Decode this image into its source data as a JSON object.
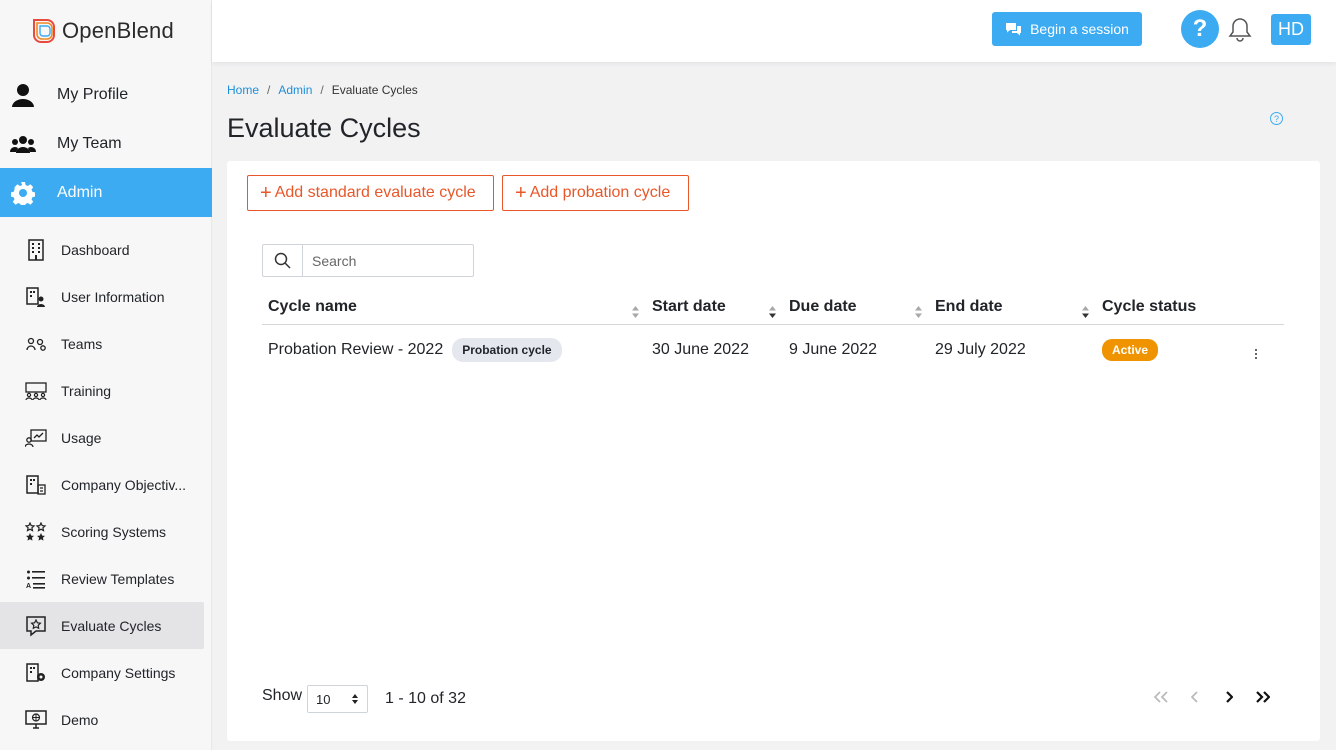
{
  "app": {
    "name": "OpenBlend"
  },
  "topbar": {
    "begin_session": "Begin a session",
    "help": "?",
    "avatar": "HD"
  },
  "sidebar": {
    "main": [
      {
        "label": "My Profile",
        "icon": "user-icon"
      },
      {
        "label": "My Team",
        "icon": "team-icon"
      },
      {
        "label": "Admin",
        "icon": "gear-icon",
        "active": true
      }
    ],
    "sub": [
      {
        "label": "Dashboard",
        "icon": "building-icon"
      },
      {
        "label": "User Information",
        "icon": "user-info-icon"
      },
      {
        "label": "Teams",
        "icon": "teams-icon"
      },
      {
        "label": "Training",
        "icon": "training-icon"
      },
      {
        "label": "Usage",
        "icon": "usage-icon"
      },
      {
        "label": "Company Objectiv...",
        "icon": "objectives-icon"
      },
      {
        "label": "Scoring Systems",
        "icon": "stars-icon"
      },
      {
        "label": "Review Templates",
        "icon": "list-icon"
      },
      {
        "label": "Evaluate Cycles",
        "icon": "chat-star-icon",
        "active": true
      },
      {
        "label": "Company Settings",
        "icon": "company-settings-icon"
      },
      {
        "label": "Demo",
        "icon": "monitor-icon"
      }
    ]
  },
  "breadcrumb": {
    "home": "Home",
    "admin": "Admin",
    "current": "Evaluate Cycles"
  },
  "page": {
    "title": "Evaluate Cycles",
    "help": "?"
  },
  "actions": {
    "add_standard": "Add standard evaluate cycle",
    "add_probation": "Add probation cycle",
    "plus": "+"
  },
  "search": {
    "placeholder": "Search",
    "value": ""
  },
  "table": {
    "headers": [
      "Cycle name",
      "Start date",
      "Due date",
      "End date",
      "Cycle status"
    ],
    "rows": [
      {
        "name": "Probation Review - 2022",
        "tag": "Probation cycle",
        "start": "30 June 2022",
        "due": "9 June 2022",
        "end": "29 July 2022",
        "status": "Active"
      }
    ]
  },
  "pagination": {
    "show_label": "Show",
    "page_size": "10",
    "info": "1 - 10 of 32"
  },
  "colors": {
    "primary": "#3cabf2",
    "accent": "#e8572a",
    "status_active": "#f09300"
  }
}
